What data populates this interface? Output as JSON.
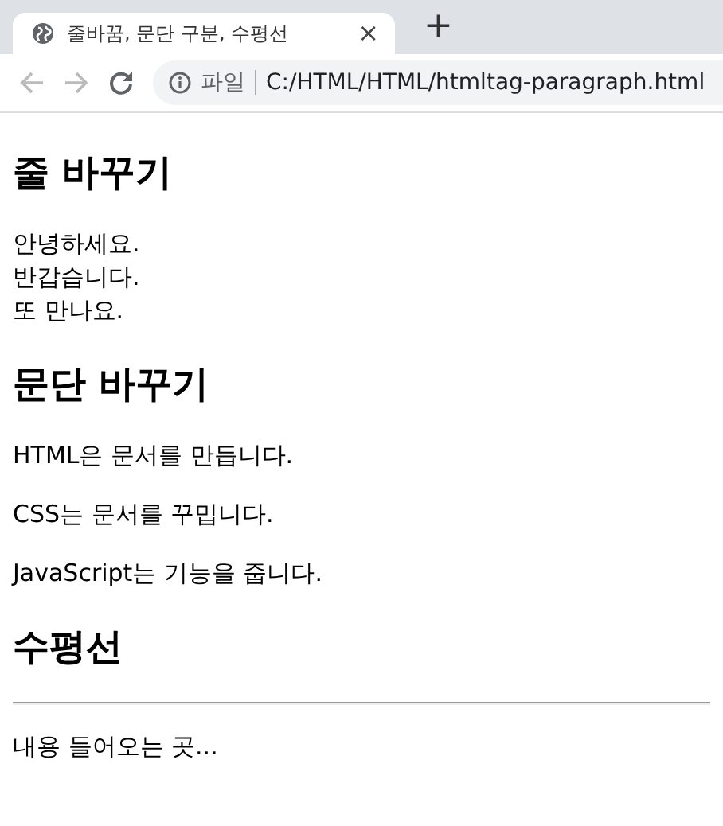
{
  "tab": {
    "title": "줄바꿈, 문단 구분, 수평선",
    "close": "×"
  },
  "new_tab": "+",
  "address_bar": {
    "scheme_label": "파일",
    "url": "C:/HTML/HTML/htmltag-paragraph.html"
  },
  "content": [
    {
      "kind": "heading",
      "text": "줄 바꾸기"
    },
    {
      "kind": "lines",
      "lines": [
        "안녕하세요.",
        "반갑습니다.",
        "또 만나요."
      ]
    },
    {
      "kind": "heading",
      "text": "문단 바꾸기"
    },
    {
      "kind": "paragraph",
      "text": "HTML은 문서를 만듭니다."
    },
    {
      "kind": "paragraph",
      "text": "CSS는 문서를 꾸밉니다."
    },
    {
      "kind": "paragraph",
      "text": "JavaScript는 기능을 줍니다."
    },
    {
      "kind": "heading",
      "text": "수평선"
    },
    {
      "kind": "rule"
    },
    {
      "kind": "paragraph",
      "text": "내용 들어오는 곳..."
    }
  ]
}
